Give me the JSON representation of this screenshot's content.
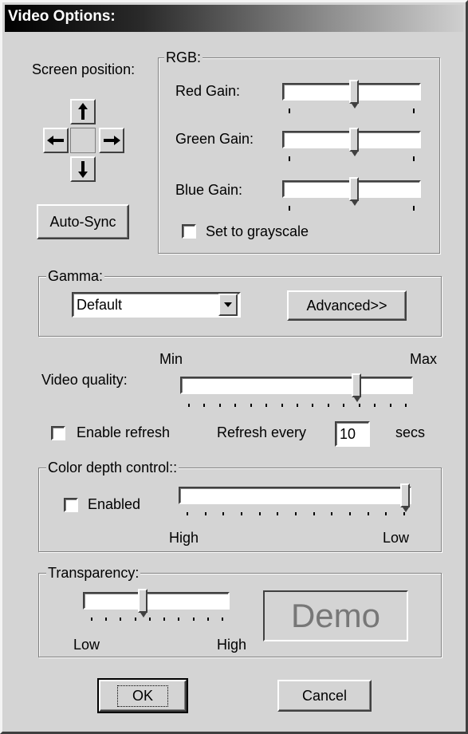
{
  "window": {
    "title": "Video Options:"
  },
  "screen_position": {
    "label": "Screen position:",
    "arrows": [
      "arrow-up-icon",
      "arrow-left-icon",
      "arrow-right-icon",
      "arrow-down-icon"
    ],
    "autosync_label": "Auto-Sync"
  },
  "rgb": {
    "legend": "RGB:",
    "red": {
      "label": "Red Gain:",
      "value": 0.52
    },
    "green": {
      "label": "Green Gain:",
      "value": 0.52
    },
    "blue": {
      "label": "Blue Gain:",
      "value": 0.52
    },
    "grayscale": {
      "label": "Set to grayscale",
      "checked": false
    }
  },
  "gamma": {
    "legend": "Gamma:",
    "selected": "Default",
    "advanced_label": "Advanced>>"
  },
  "video_quality": {
    "label": "Video quality:",
    "min_label": "Min",
    "max_label": "Max",
    "value": 0.77
  },
  "refresh": {
    "enable_label": "Enable refresh",
    "checked": false,
    "every_label": "Refresh every",
    "value": "10",
    "unit": "secs"
  },
  "color_depth": {
    "legend": "Color depth control::",
    "enabled_label": "Enabled",
    "checked": false,
    "high_label": "High",
    "low_label": "Low",
    "value": 1.0
  },
  "transparency": {
    "legend": "Transparency:",
    "low_label": "Low",
    "high_label": "High",
    "value": 0.4,
    "demo_label": "Demo"
  },
  "buttons": {
    "ok_label": "OK",
    "cancel_label": "Cancel"
  },
  "colors": {
    "dialog_bg": "#d4d4d4",
    "titlebar_start": "#000000",
    "titlebar_end": "#cfcfcf"
  }
}
